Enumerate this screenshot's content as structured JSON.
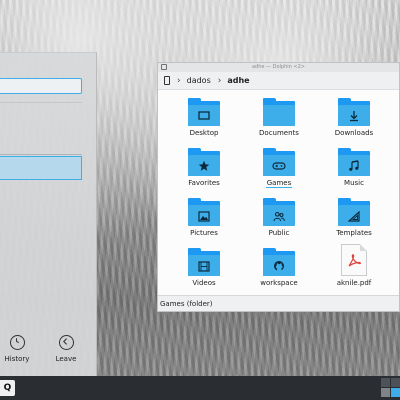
{
  "launcher": {
    "actions": [
      {
        "label": "History",
        "icon": "clock-icon"
      },
      {
        "label": "Leave",
        "icon": "arrow-left-circle-icon"
      }
    ]
  },
  "dolphin": {
    "title": "adhe — Dolphin <2>",
    "breadcrumb": [
      "dados",
      "adhe"
    ],
    "items": [
      {
        "label": "Desktop",
        "icon": "desktop-folder-icon",
        "type": "folder"
      },
      {
        "label": "Documents",
        "icon": "documents-folder-icon",
        "type": "folder"
      },
      {
        "label": "Downloads",
        "icon": "downloads-folder-icon",
        "type": "folder"
      },
      {
        "label": "Favorites",
        "icon": "favorites-folder-icon",
        "type": "folder"
      },
      {
        "label": "Games",
        "icon": "games-folder-icon",
        "type": "folder",
        "selected": true
      },
      {
        "label": "Music",
        "icon": "music-folder-icon",
        "type": "folder"
      },
      {
        "label": "Pictures",
        "icon": "pictures-folder-icon",
        "type": "folder"
      },
      {
        "label": "Public",
        "icon": "public-folder-icon",
        "type": "folder"
      },
      {
        "label": "Templates",
        "icon": "templates-folder-icon",
        "type": "folder"
      },
      {
        "label": "Videos",
        "icon": "videos-folder-icon",
        "type": "folder"
      },
      {
        "label": "workspace",
        "icon": "workspace-folder-icon",
        "type": "folder"
      },
      {
        "label": "aknile.pdf",
        "icon": "pdf-file-icon",
        "type": "file"
      }
    ],
    "status": "Games (folder)"
  },
  "taskbar": {
    "launcher_label": "Q"
  },
  "colors": {
    "accent": "#3daee9",
    "folder_dark": "#1d99f3",
    "taskbar": "#2a2e32",
    "pdf_red": "#e0413a"
  }
}
